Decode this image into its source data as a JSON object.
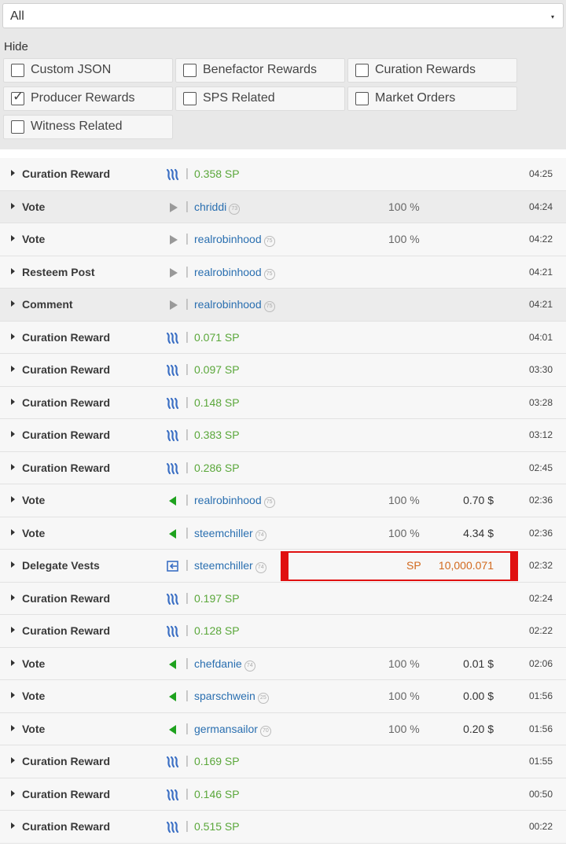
{
  "filter": {
    "selected": "All",
    "caret": "▾",
    "hide_label": "Hide",
    "checkboxes": [
      {
        "label": "Custom JSON",
        "checked": false
      },
      {
        "label": "Benefactor Rewards",
        "checked": false
      },
      {
        "label": "Curation Rewards",
        "checked": false
      },
      {
        "label": "Producer Rewards",
        "checked": true
      },
      {
        "label": "SPS Related",
        "checked": false
      },
      {
        "label": "Market Orders",
        "checked": false
      },
      {
        "label": "Witness Related",
        "checked": false
      }
    ]
  },
  "colors": {
    "amount_green": "#5aa73a",
    "user_blue": "#2a6fb0",
    "vote_green": "#1ea21e",
    "steem_blue": "#3b6fc4",
    "highlight_red": "#e01010",
    "delegate_orange": "#d2691e"
  },
  "rows": [
    {
      "type": "Curation Reward",
      "icon": "steem-icon",
      "amount": "0.358 SP",
      "time": "04:25",
      "alt": false
    },
    {
      "type": "Vote",
      "icon": "play-gray-icon",
      "user": "chriddi",
      "rep": "73",
      "pct": "100 %",
      "time": "04:24",
      "alt": true
    },
    {
      "type": "Vote",
      "icon": "play-gray-icon",
      "user": "realrobinhood",
      "rep": "75",
      "pct": "100 %",
      "time": "04:22",
      "alt": false
    },
    {
      "type": "Resteem Post",
      "icon": "play-gray-icon",
      "user": "realrobinhood",
      "rep": "75",
      "time": "04:21",
      "alt": false
    },
    {
      "type": "Comment",
      "icon": "play-gray-icon",
      "user": "realrobinhood",
      "rep": "75",
      "time": "04:21",
      "alt": true
    },
    {
      "type": "Curation Reward",
      "icon": "steem-icon",
      "amount": "0.071 SP",
      "time": "04:01",
      "alt": false
    },
    {
      "type": "Curation Reward",
      "icon": "steem-icon",
      "amount": "0.097 SP",
      "time": "03:30",
      "alt": false
    },
    {
      "type": "Curation Reward",
      "icon": "steem-icon",
      "amount": "0.148 SP",
      "time": "03:28",
      "alt": false
    },
    {
      "type": "Curation Reward",
      "icon": "steem-icon",
      "amount": "0.383 SP",
      "time": "03:12",
      "alt": false
    },
    {
      "type": "Curation Reward",
      "icon": "steem-icon",
      "amount": "0.286 SP",
      "time": "02:45",
      "alt": false
    },
    {
      "type": "Vote",
      "icon": "vote-green-icon",
      "user": "realrobinhood",
      "rep": "75",
      "pct": "100 %",
      "usd": "0.70 $",
      "time": "02:36",
      "alt": false
    },
    {
      "type": "Vote",
      "icon": "vote-green-icon",
      "user": "steemchiller",
      "rep": "74",
      "pct": "100 %",
      "usd": "4.34 $",
      "time": "02:36",
      "alt": false
    },
    {
      "type": "Delegate Vests",
      "icon": "delegate-icon",
      "user": "steemchiller",
      "rep": "74",
      "sp_unit": "SP",
      "sp_amount": "10,000.071",
      "highlight": true,
      "time": "02:32",
      "alt": false
    },
    {
      "type": "Curation Reward",
      "icon": "steem-icon",
      "amount": "0.197 SP",
      "time": "02:24",
      "alt": false
    },
    {
      "type": "Curation Reward",
      "icon": "steem-icon",
      "amount": "0.128 SP",
      "time": "02:22",
      "alt": false
    },
    {
      "type": "Vote",
      "icon": "vote-green-icon",
      "user": "chefdanie",
      "rep": "74",
      "pct": "100 %",
      "usd": "0.01 $",
      "time": "02:06",
      "alt": false
    },
    {
      "type": "Vote",
      "icon": "vote-green-icon",
      "user": "sparschwein",
      "rep": "25",
      "pct": "100 %",
      "usd": "0.00 $",
      "time": "01:56",
      "alt": false
    },
    {
      "type": "Vote",
      "icon": "vote-green-icon",
      "user": "germansailor",
      "rep": "70",
      "pct": "100 %",
      "usd": "0.20 $",
      "time": "01:56",
      "alt": false
    },
    {
      "type": "Curation Reward",
      "icon": "steem-icon",
      "amount": "0.169 SP",
      "time": "01:55",
      "alt": false
    },
    {
      "type": "Curation Reward",
      "icon": "steem-icon",
      "amount": "0.146 SP",
      "time": "00:50",
      "alt": false
    },
    {
      "type": "Curation Reward",
      "icon": "steem-icon",
      "amount": "0.515 SP",
      "time": "00:22",
      "alt": false
    }
  ]
}
